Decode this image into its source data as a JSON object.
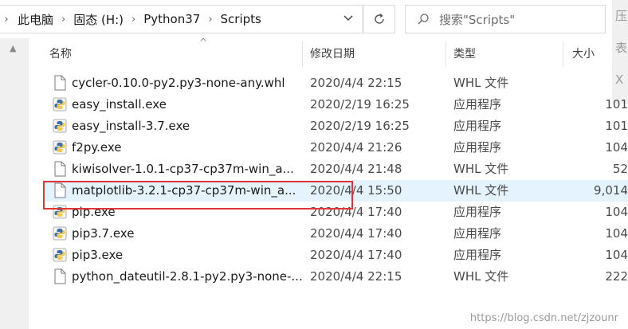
{
  "address_bar": {
    "crumbs": [
      "此电脑",
      "固态 (H:)",
      "Python37",
      "Scripts"
    ]
  },
  "search": {
    "placeholder": "搜索\"Scripts\""
  },
  "side_fragments": [
    "压",
    "表",
    "X 家"
  ],
  "columns": {
    "name": "名称",
    "date": "修改日期",
    "type": "类型",
    "size": "大小"
  },
  "files": [
    {
      "name": "cycler-0.10.0-py2.py3-none-any.whl",
      "date": "2020/4/4 22:15",
      "type": "WHL 文件",
      "size": "",
      "icon": "file-icon",
      "selected": false
    },
    {
      "name": "easy_install.exe",
      "date": "2020/2/19 16:25",
      "type": "应用程序",
      "size": "101",
      "icon": "python-exe-icon",
      "selected": false
    },
    {
      "name": "easy_install-3.7.exe",
      "date": "2020/2/19 16:25",
      "type": "应用程序",
      "size": "101",
      "icon": "python-exe-icon",
      "selected": false
    },
    {
      "name": "f2py.exe",
      "date": "2020/4/4 21:26",
      "type": "应用程序",
      "size": "104",
      "icon": "python-exe-icon",
      "selected": false
    },
    {
      "name": "kiwisolver-1.0.1-cp37-cp37m-win_a...",
      "date": "2020/4/4 21:48",
      "type": "WHL 文件",
      "size": "52",
      "icon": "file-icon",
      "selected": false
    },
    {
      "name": "matplotlib-3.2.1-cp37-cp37m-win_a...",
      "date": "2020/4/4 15:50",
      "type": "WHL 文件",
      "size": "9,014",
      "icon": "file-icon",
      "selected": true
    },
    {
      "name": "pip.exe",
      "date": "2020/4/4 17:40",
      "type": "应用程序",
      "size": "104",
      "icon": "python-exe-icon",
      "selected": false
    },
    {
      "name": "pip3.7.exe",
      "date": "2020/4/4 17:40",
      "type": "应用程序",
      "size": "104",
      "icon": "python-exe-icon",
      "selected": false
    },
    {
      "name": "pip3.exe",
      "date": "2020/4/4 17:40",
      "type": "应用程序",
      "size": "104",
      "icon": "python-exe-icon",
      "selected": false
    },
    {
      "name": "python_dateutil-2.8.1-py2.py3-none-...",
      "date": "2020/4/4 22:15",
      "type": "WHL 文件",
      "size": "222",
      "icon": "file-icon",
      "selected": false
    }
  ],
  "watermark": "https://blog.csdn.net/zjzounr",
  "colors": {
    "selection": "#e5f3ff",
    "highlight_border": "#e0363a"
  }
}
